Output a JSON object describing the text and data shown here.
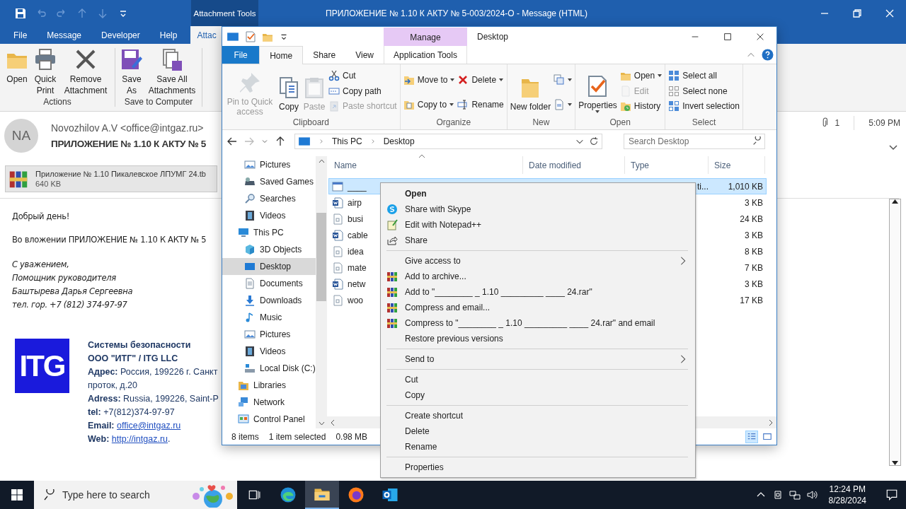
{
  "outlook": {
    "title": "ПРИЛОЖЕНИЕ № 1.10 К АКТУ № 5-003/2024-О  -  Message (HTML)",
    "context_tab": "Attachment Tools",
    "tabs": [
      {
        "label": "File",
        "selected": false
      },
      {
        "label": "Message",
        "selected": false
      },
      {
        "label": "Developer",
        "selected": false
      },
      {
        "label": "Help",
        "selected": false
      },
      {
        "label": "Attac",
        "selected": true
      }
    ],
    "ribbon_groups": [
      {
        "label": "Actions",
        "buttons": [
          {
            "label": "Open",
            "kind": "open"
          },
          {
            "label": "Quick Print",
            "kind": "print"
          },
          {
            "label": "Remove Attachment",
            "kind": "remove"
          }
        ]
      },
      {
        "label": "Save to Computer",
        "buttons": [
          {
            "label": "Save As",
            "kind": "saveas"
          },
          {
            "label": "Save All Attachments",
            "kind": "saveall"
          }
        ]
      }
    ],
    "sender": {
      "initials": "NA",
      "from": "Novozhilov A.V <office@intgaz.ru>",
      "subject": "ПРИЛОЖЕНИЕ № 1.10 К АКТУ № 5"
    },
    "attachment_count": "1",
    "time": "5:09 PM",
    "attachment": {
      "name": "Приложение № 1.10 Пикалевское ЛПУМГ 24.tb",
      "size": "640 KB"
    },
    "body": {
      "greeting": "Добрый день!",
      "text": "Во вложении ПРИЛОЖЕНИЕ № 1.10 К АКТУ № 5",
      "signature": [
        "С уважением,",
        "Помощник руководителя",
        "Баштырева Дарья Сергеевна",
        "тел. гор. +7 (812) 374-97-97"
      ],
      "logo": "ITG",
      "company": [
        {
          "kind": "title",
          "text": "Системы безопасности"
        },
        {
          "kind": "title",
          "text": "ООО \"ИТГ\" / ITG LLC"
        },
        {
          "kind": "field",
          "label": "Адрес:",
          "value": "Россия, 199226  г. Санкт"
        },
        {
          "kind": "plain",
          "text": "проток, д.20"
        },
        {
          "kind": "field",
          "label": "Adress:",
          "value": "Russia, 199226,  Saint-P"
        },
        {
          "kind": "field",
          "label": "tel:",
          "value": "+7(812)374-97-97"
        },
        {
          "kind": "link",
          "label": "Email:",
          "value": "office@intgaz.ru"
        },
        {
          "kind": "link",
          "label": "Web:",
          "value": "http://intgaz.ru",
          "after": "."
        }
      ]
    }
  },
  "explorer": {
    "title": "Desktop",
    "manage": "Manage",
    "tabs": [
      {
        "label": "File",
        "kind": "file",
        "selected": false
      },
      {
        "label": "Home",
        "kind": "tab",
        "selected": true
      },
      {
        "label": "Share",
        "kind": "tab",
        "selected": false
      },
      {
        "label": "View",
        "kind": "tab",
        "selected": false
      },
      {
        "label": "Application Tools",
        "kind": "context",
        "selected": false
      }
    ],
    "groups": [
      {
        "label": "Clipboard",
        "columns": [
          [
            {
              "label": "Pin to Quick access",
              "kind": "pin",
              "disabled": true,
              "dropdown": false
            }
          ],
          [
            {
              "label": "Copy",
              "kind": "copy",
              "disabled": false,
              "dropdown": false
            }
          ],
          [
            {
              "label": "Paste",
              "kind": "paste",
              "disabled": true,
              "dropdown": false
            }
          ],
          [
            {
              "label": "Cut",
              "kind": "cut",
              "disabled": false,
              "dropdown": false
            },
            {
              "label": "Copy path",
              "kind": "copypath",
              "disabled": false,
              "dropdown": false
            },
            {
              "label": "Paste shortcut",
              "kind": "pasteshortcut",
              "disabled": true,
              "dropdown": false
            }
          ]
        ]
      },
      {
        "label": "Organize",
        "columns": [
          [
            {
              "label": "Move to",
              "kind": "moveto",
              "disabled": false,
              "dropdown": true
            },
            {
              "label": "Copy to",
              "kind": "copyto",
              "disabled": false,
              "dropdown": true
            }
          ],
          [
            {
              "label": "Delete",
              "kind": "delete",
              "disabled": false,
              "dropdown": true
            },
            {
              "label": "Rename",
              "kind": "rename",
              "disabled": false,
              "dropdown": false
            }
          ]
        ]
      },
      {
        "label": "New",
        "columns": [
          [
            {
              "label": "New folder",
              "kind": "newfolder",
              "disabled": false,
              "dropdown": false
            }
          ],
          [
            {
              "kind": "newitem",
              "disabled": false,
              "dropdown": true
            },
            {
              "kind": "easyaccess",
              "disabled": false,
              "dropdown": true
            }
          ]
        ]
      },
      {
        "label": "Open",
        "columns": [
          [
            {
              "label": "Properties",
              "kind": "properties",
              "disabled": false,
              "dropdown": true
            }
          ],
          [
            {
              "label": "Open",
              "kind": "open",
              "disabled": false,
              "dropdown": true
            },
            {
              "label": "Edit",
              "kind": "edit",
              "disabled": true,
              "dropdown": false
            },
            {
              "label": "History",
              "kind": "history",
              "disabled": false,
              "dropdown": false
            }
          ]
        ]
      },
      {
        "label": "Select",
        "columns": [
          [
            {
              "label": "Select all",
              "kind": "selectall",
              "disabled": false,
              "dropdown": false
            },
            {
              "label": "Select none",
              "kind": "selectnone",
              "disabled": false,
              "dropdown": false
            },
            {
              "label": "Invert selection",
              "kind": "invert",
              "disabled": false,
              "dropdown": false
            }
          ]
        ]
      }
    ],
    "address": [
      "This PC",
      "Desktop"
    ],
    "search_placeholder": "Search Desktop",
    "nav": [
      {
        "children": [
          {
            "label": "Pictures",
            "kind": "pictures",
            "selected": false
          },
          {
            "label": "Saved Games",
            "kind": "games",
            "selected": false
          },
          {
            "label": "Searches",
            "kind": "searches",
            "selected": false
          },
          {
            "label": "Videos",
            "kind": "videos",
            "selected": false
          }
        ]
      },
      {
        "label": "This PC",
        "kind": "pc",
        "selected": false,
        "children": [
          {
            "label": "3D Objects",
            "kind": "objects",
            "selected": false
          },
          {
            "label": "Desktop",
            "kind": "desktop",
            "selected": true
          },
          {
            "label": "Documents",
            "kind": "documents",
            "selected": false
          },
          {
            "label": "Downloads",
            "kind": "downloads",
            "selected": false
          },
          {
            "label": "Music",
            "kind": "music",
            "selected": false
          },
          {
            "label": "Pictures",
            "kind": "pictures",
            "selected": false
          },
          {
            "label": "Videos",
            "kind": "videos",
            "selected": false
          },
          {
            "label": "Local Disk (C:)",
            "kind": "disk",
            "selected": false
          }
        ]
      },
      {
        "label": "Libraries",
        "kind": "libraries",
        "selected": false
      },
      {
        "label": "Network",
        "kind": "network",
        "selected": false
      },
      {
        "label": "Control Panel",
        "kind": "control",
        "selected": false
      }
    ],
    "columns": [
      "Name",
      "Date modified",
      "Type",
      "Size"
    ],
    "files": [
      {
        "name": "____",
        "type": "ti...",
        "size": "1,010 KB",
        "kind": "app",
        "selected": true
      },
      {
        "name": "airp",
        "size": "3 KB",
        "kind": "word",
        "selected": false
      },
      {
        "name": "busi",
        "size": "24 KB",
        "kind": "text",
        "selected": false
      },
      {
        "name": "cable",
        "size": "3 KB",
        "kind": "word",
        "selected": false
      },
      {
        "name": "idea",
        "size": "8 KB",
        "kind": "text",
        "selected": false
      },
      {
        "name": "mate",
        "size": "7 KB",
        "kind": "text",
        "selected": false
      },
      {
        "name": "netw",
        "size": "3 KB",
        "kind": "word",
        "selected": false
      },
      {
        "name": "woo",
        "size": "17 KB",
        "kind": "text",
        "selected": false
      }
    ],
    "status": {
      "count": "8 items",
      "selection": "1 item selected",
      "size": "0.98 MB"
    }
  },
  "context_menu": {
    "items": [
      {
        "kind": "default",
        "label": "Open"
      },
      {
        "kind": "skype",
        "label": "Share with Skype"
      },
      {
        "kind": "notepad",
        "label": "Edit with Notepad++"
      },
      {
        "kind": "share",
        "label": "Share"
      },
      {
        "kind": "separator"
      },
      {
        "kind": "submenu",
        "label": "Give access to"
      },
      {
        "kind": "archive",
        "label": "Add to archive..."
      },
      {
        "kind": "archive",
        "label": "Add to \"________ _ 1.10 _________ ____ 24.rar\""
      },
      {
        "kind": "archive",
        "label": "Compress and email..."
      },
      {
        "kind": "archive",
        "label": "Compress to \"________ _ 1.10 _________ ____ 24.rar\" and email"
      },
      {
        "kind": "plain",
        "label": "Restore previous versions"
      },
      {
        "kind": "separator"
      },
      {
        "kind": "submenu",
        "label": "Send to"
      },
      {
        "kind": "separator"
      },
      {
        "kind": "plain",
        "label": "Cut"
      },
      {
        "kind": "plain",
        "label": "Copy"
      },
      {
        "kind": "separator"
      },
      {
        "kind": "plain",
        "label": "Create shortcut"
      },
      {
        "kind": "plain",
        "label": "Delete"
      },
      {
        "kind": "plain",
        "label": "Rename"
      },
      {
        "kind": "separator"
      },
      {
        "kind": "plain",
        "label": "Properties"
      }
    ]
  },
  "taskbar": {
    "search_placeholder": "Type here to search",
    "apps": [
      {
        "kind": "taskview",
        "selected": false
      },
      {
        "kind": "edge",
        "selected": false
      },
      {
        "kind": "explorer",
        "selected": true
      },
      {
        "kind": "firefox",
        "selected": false
      },
      {
        "kind": "outlook",
        "selected": false
      }
    ],
    "time": "12:24 PM",
    "date": "8/28/2024"
  }
}
